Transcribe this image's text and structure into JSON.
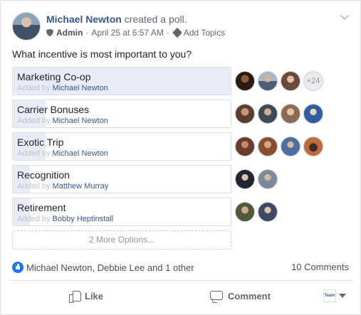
{
  "post": {
    "author": "Michael Newton",
    "action": "created a poll.",
    "role": "Admin",
    "separator": "·",
    "timestamp": "April 25 at 6:57 AM",
    "add_topics": "Add Topics"
  },
  "poll": {
    "question": "What incentive is most important to you?",
    "added_by_prefix": "Added by",
    "options": [
      {
        "label": "Marketing Co-op",
        "added_by": "Michael Newton",
        "vote_share": 1.0,
        "voters": 3,
        "extra_voters": "+24"
      },
      {
        "label": "Carrier Bonuses",
        "added_by": "Michael Newton",
        "vote_share": 0.15,
        "voters": 4
      },
      {
        "label": "Exotic Trip",
        "added_by": "Michael Newton",
        "vote_share": 0.15,
        "voters": 4
      },
      {
        "label": "Recognition",
        "added_by": "Matthew Murray",
        "vote_share": 0.08,
        "voters": 2
      },
      {
        "label": "Retirement",
        "added_by": "Bobby Heptinstall",
        "vote_share": 0.08,
        "voters": 2
      }
    ],
    "more_options": "2 More Options..."
  },
  "footer": {
    "reactions_text": "Michael Newton, Debbie Lee and 1 other",
    "comments_count": "10 Comments",
    "like_label": "Like",
    "comment_label": "Comment",
    "profile_badge": "Team"
  },
  "colors": {
    "link": "#365899",
    "vote_fill": "#e9ebf6",
    "like_blue": "#1877f2"
  }
}
